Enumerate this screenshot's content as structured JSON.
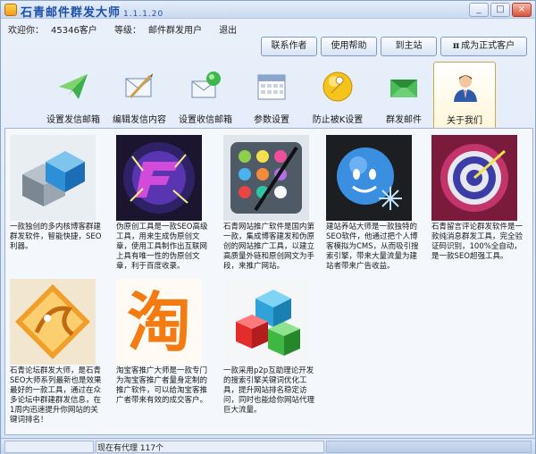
{
  "window": {
    "title": "石青邮件群发大师",
    "version": "1.1.1.20",
    "buttons": {
      "minimize": "_",
      "maximize": "□",
      "close": "×"
    }
  },
  "user": {
    "welcome_label": "欢迎你：",
    "username": "45346客户",
    "level_label": "等级：",
    "level": "邮件群发用户",
    "logout": "退出"
  },
  "actions": {
    "contact_author": "联系作者",
    "help": "使用帮助",
    "main_site": "到主站",
    "become_customer_symbol": "π",
    "become_customer": "成为正式客户"
  },
  "toolbar": [
    {
      "id": "sender",
      "label": "设置发信邮箱",
      "icon": "paper-plane-icon"
    },
    {
      "id": "content",
      "label": "编辑发信内容",
      "icon": "edit-mail-icon"
    },
    {
      "id": "receiver",
      "label": "设置收信邮箱",
      "icon": "receive-mail-icon"
    },
    {
      "id": "params",
      "label": "参数设置",
      "icon": "calendar-settings-icon"
    },
    {
      "id": "antiblock",
      "label": "防止被K设置",
      "icon": "wrench-icon"
    },
    {
      "id": "bulk",
      "label": "群发邮件",
      "icon": "send-envelope-icon"
    },
    {
      "id": "about",
      "label": "关于我们",
      "icon": "person-icon",
      "active": true
    }
  ],
  "products": [
    {
      "name": "blog-group-tool",
      "desc": "一款独创的多内核博客群建群发软件，智能快捷，SEO利器。"
    },
    {
      "name": "pseudo-original-tool",
      "desc": "伪原创工具是一款SEO高级工具，用来生成伪原创文章，使用工具制作出互联网上具有唯一性的伪原创文章，利于百度收录。"
    },
    {
      "name": "site-promotion-tool",
      "desc": "石青网站推广软件是国内第一款，集成博客建发和伪原创的网站推广工具，以建立高质量外链和原创网文为手段，来推广网站。"
    },
    {
      "name": "site-builder-tool",
      "desc": "建站养站大师是一款独特的SEO软件，他通过把个人博客模拟为CMS，从而吸引搜索引擎，带来大量流量为建站者带来广告收益。"
    },
    {
      "name": "comment-tool",
      "desc": "石青留言评论群发软件是一款纯消息群发工具，完全验证码识别，100%全自动，是一款SEO超强工具。"
    },
    {
      "name": "forum-tool",
      "desc": "石青论坛群发大师，是石青SEO大师系列最新也是效果最好的一款工具，通过在众多论坛中群建群发信息，在1周内迅速提升你网站的关键词排名！"
    },
    {
      "name": "taobao-tool",
      "desc": "淘宝客推广大师是一款专门为淘宝客推广者量身定制的推广软件，可以给淘宝客推广者带来有效的成交客户。"
    },
    {
      "name": "p2p-link-tool",
      "desc": "一款采用p2p互助理论开发的搜索引擎关键词优化工具，提升网站排名稳定访问，同时也能给你网站代理巨大流量。"
    }
  ],
  "taobao_glyph": "淘",
  "status": {
    "agents_text": "现在有代理 117个"
  }
}
